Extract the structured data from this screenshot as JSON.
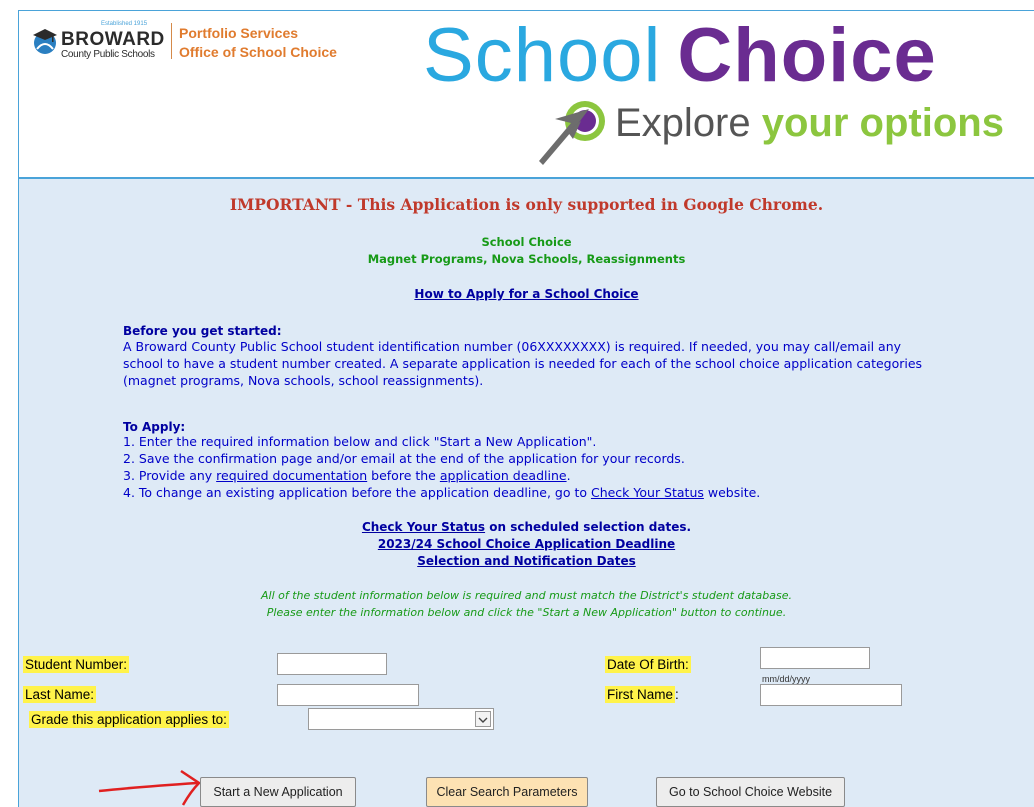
{
  "header": {
    "logo": {
      "name": "BROWARD",
      "subtitle": "County Public Schools",
      "established": "Established 1915"
    },
    "org_line1": "Portfolio Services",
    "org_line2": "Office of School Choice",
    "brand_word1": "School",
    "brand_word2": "Choice",
    "tagline_part1": "Explore ",
    "tagline_part2": "your options",
    "colors": {
      "school": "#2aa8e0",
      "choice": "#6a2c91",
      "options": "#8cc63f",
      "org": "#e07b2e"
    }
  },
  "notice": {
    "important": "IMPORTANT - This Application is only supported in Google Chrome.",
    "title": "School Choice",
    "subtitle": "Magnet Programs, Nova Schools, Reassignments",
    "howto_link": "How to Apply for a School Choice"
  },
  "before": {
    "heading": "Before you get started:",
    "body": "A Broward County Public School student identification number (06XXXXXXXX) is required. If needed, you may call/email any school to have a student number created. A separate application is needed for each of the school choice application categories (magnet programs, Nova schools, school reassignments)."
  },
  "apply": {
    "heading": "To Apply:",
    "step1": "1. Enter the required information below and click \"Start a New Application\".",
    "step2": "2. Save the confirmation page and/or email at the end of the application for your records.",
    "step3_prefix": "3. Provide any ",
    "step3_link1": "required documentation",
    "step3_middle": " before the ",
    "step3_link2": "application deadline",
    "step3_suffix": ".",
    "step4_prefix": "4. To change an existing application before the application deadline, go to ",
    "step4_link": "Check Your Status",
    "step4_suffix": " website."
  },
  "links": {
    "check_status": "Check Your Status",
    "check_status_suffix": " on scheduled selection dates.",
    "deadline": "2023/24 School Choice Application Deadline",
    "dates": "Selection and Notification Dates"
  },
  "form_note": {
    "line1": "All of the student information below is required and must match the District's student database.",
    "line2": "Please enter the information below and click the \"Start a New Application\" button to continue."
  },
  "form": {
    "student_number_label": "Student Number:",
    "last_name_label": "Last Name:",
    "grade_label": "Grade this application applies to:",
    "dob_label": "Date Of Birth:",
    "dob_hint": "mm/dd/yyyy",
    "first_name_label_hl": "First Name",
    "first_name_label_rest": ":",
    "student_number_value": "",
    "last_name_value": "",
    "dob_value": "",
    "first_name_value": "",
    "grade_value": ""
  },
  "buttons": {
    "start": "Start a New Application",
    "clear": "Clear Search Parameters",
    "goto": "Go to School Choice Website"
  }
}
